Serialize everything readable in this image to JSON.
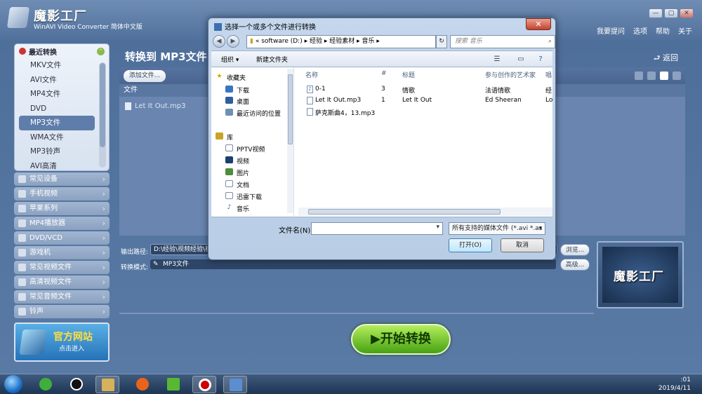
{
  "app": {
    "name": "魔影工厂",
    "subtitle": "WinAVI Video Converter 简体中文版",
    "menu": [
      "我要提问",
      "选项",
      "帮助",
      "关于"
    ],
    "win_buttons": [
      "—",
      "▢",
      "✕"
    ]
  },
  "sidebar": {
    "open_category": "最近转换",
    "formats": [
      "MKV文件",
      "AVI文件",
      "MP4文件",
      "DVD",
      "MP3文件",
      "WMA文件",
      "MP3铃声",
      "AVI高清"
    ],
    "selected_index": 4,
    "categories": [
      "常见设备",
      "手机视频",
      "苹果系列",
      "MP4播放器",
      "DVD/VCD",
      "游戏机",
      "常见视频文件",
      "高清视频文件",
      "常见音频文件",
      "铃声"
    ],
    "website": {
      "title": "官方网站",
      "sub": "点击进入"
    }
  },
  "main": {
    "title": "转换到 MP3文件",
    "back": "返回",
    "add_file": "添加文件...",
    "file_header": "文件",
    "files": [
      "Let It Out.mp3"
    ],
    "output_label": "输出路径:",
    "output_path": "D:\\经验\\视频经验\\视",
    "browse": "浏览...",
    "mode_label": "转换模式:",
    "mode_value": "MP3文件",
    "advanced": "高级...",
    "preview_text": "魔影工厂",
    "start": "开始转换"
  },
  "dialog": {
    "title": "选择一个或多个文件进行转换",
    "close": "✕",
    "path": [
      "«",
      "software (D:)",
      "经验",
      "经验素材",
      "音乐"
    ],
    "search_placeholder": "搜索 音乐",
    "organize": "组织 ▾",
    "new_folder": "新建文件夹",
    "nav": {
      "favorites": "收藏夹",
      "fav_items": [
        "下载",
        "桌面",
        "最近访问的位置"
      ],
      "libraries": "库",
      "lib_items": [
        "PPTV视频",
        "视频",
        "图片",
        "文档",
        "迅雷下载",
        "音乐"
      ]
    },
    "columns": [
      "名称",
      "#",
      "标题",
      "参与创作的艺术家",
      "唱"
    ],
    "files": [
      {
        "name": "0-1",
        "num": "3",
        "title": "情歌",
        "artist": "法语情歌",
        "extra": "经"
      },
      {
        "name": "Let It Out.mp3",
        "num": "1",
        "title": "Let It Out",
        "artist": "Ed Sheeran",
        "extra": "Lo"
      },
      {
        "name": "萨克斯曲4，13.mp3",
        "num": "",
        "title": "",
        "artist": "",
        "extra": ""
      }
    ],
    "filename_label": "文件名(N):",
    "filename_value": "",
    "filetype": "所有支持的媒体文件 (*.avi *.as",
    "open": "打开(O)",
    "cancel": "取消"
  },
  "taskbar": {
    "time": ":01",
    "date": "2019/4/11"
  }
}
